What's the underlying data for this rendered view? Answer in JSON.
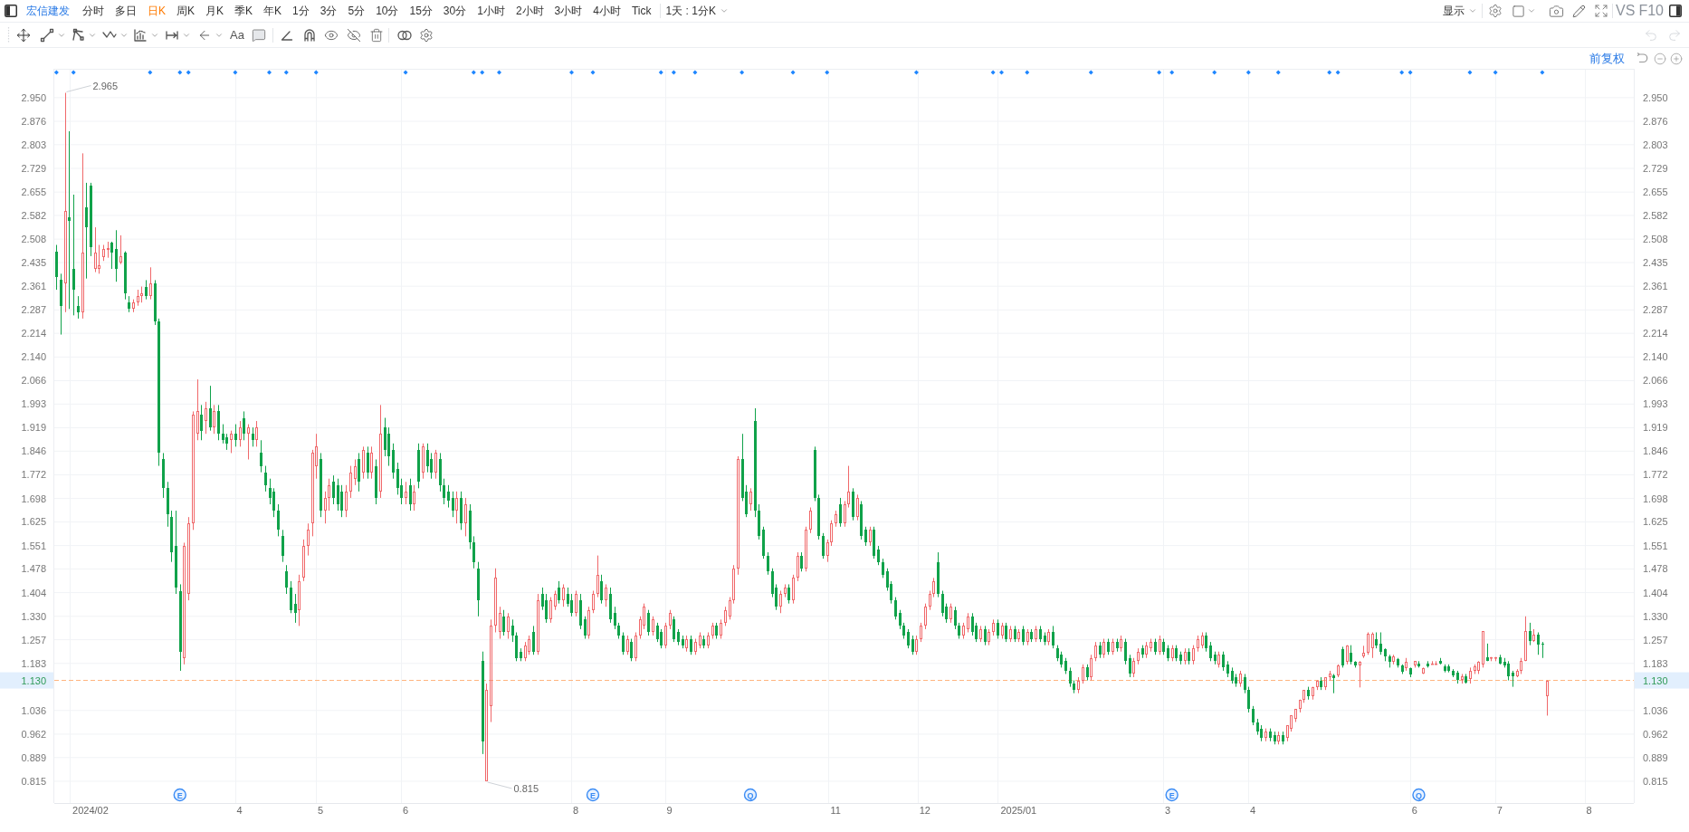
{
  "toolbar": {
    "symbol": "宏信建发",
    "periods": [
      {
        "label": "分时",
        "selected": false
      },
      {
        "label": "多日",
        "selected": false
      },
      {
        "label": "日K",
        "selected": true
      },
      {
        "label": "周K",
        "selected": false
      },
      {
        "label": "月K",
        "selected": false
      },
      {
        "label": "季K",
        "selected": false
      },
      {
        "label": "年K",
        "selected": false
      },
      {
        "label": "1分",
        "selected": false
      },
      {
        "label": "3分",
        "selected": false
      },
      {
        "label": "5分",
        "selected": false
      },
      {
        "label": "10分",
        "selected": false
      },
      {
        "label": "15分",
        "selected": false
      },
      {
        "label": "30分",
        "selected": false
      },
      {
        "label": "1小时",
        "selected": false
      },
      {
        "label": "2小时",
        "selected": false
      },
      {
        "label": "3小时",
        "selected": false
      },
      {
        "label": "4小时",
        "selected": false
      },
      {
        "label": "Tick",
        "selected": false
      }
    ],
    "interval_menu": "1天 : 1分K",
    "display_menu": "显示",
    "compare_button": "VS",
    "f10_button": "F10"
  },
  "drawing_toolbar": {
    "text_tool": "Aa",
    "undo": {
      "disabled": true
    },
    "redo": {
      "disabled": true
    }
  },
  "chart": {
    "adjust_mode": "前复权",
    "chart_data": {
      "type": "candlestick",
      "grid": true,
      "ylim": [
        0.747,
        3.04
      ],
      "ref_lines": [
        {
          "axis": "y",
          "value": 1.13
        }
      ],
      "yticks": [
        {
          "value": 2.95,
          "label": "2.950"
        },
        {
          "value": 2.876,
          "label": "2.876"
        },
        {
          "value": 2.803,
          "label": "2.803"
        },
        {
          "value": 2.729,
          "label": "2.729"
        },
        {
          "value": 2.655,
          "label": "2.655"
        },
        {
          "value": 2.582,
          "label": "2.582"
        },
        {
          "value": 2.508,
          "label": "2.508"
        },
        {
          "value": 2.435,
          "label": "2.435"
        },
        {
          "value": 2.361,
          "label": "2.361"
        },
        {
          "value": 2.287,
          "label": "2.287"
        },
        {
          "value": 2.214,
          "label": "2.214"
        },
        {
          "value": 2.14,
          "label": "2.140"
        },
        {
          "value": 2.066,
          "label": "2.066"
        },
        {
          "value": 1.993,
          "label": "1.993"
        },
        {
          "value": 1.919,
          "label": "1.919"
        },
        {
          "value": 1.846,
          "label": "1.846"
        },
        {
          "value": 1.772,
          "label": "1.772"
        },
        {
          "value": 1.698,
          "label": "1.698"
        },
        {
          "value": 1.625,
          "label": "1.625"
        },
        {
          "value": 1.551,
          "label": "1.551"
        },
        {
          "value": 1.478,
          "label": "1.478"
        },
        {
          "value": 1.404,
          "label": "1.404"
        },
        {
          "value": 1.33,
          "label": "1.330"
        },
        {
          "value": 1.257,
          "label": "1.257"
        },
        {
          "value": 1.183,
          "label": "1.183"
        },
        {
          "value": 1.036,
          "label": "1.036"
        },
        {
          "value": 0.962,
          "label": "0.962"
        },
        {
          "value": 0.889,
          "label": "0.889"
        },
        {
          "value": 0.815,
          "label": "0.815"
        }
      ],
      "categories": [
        null,
        null,
        null,
        null,
        null,
        null,
        null,
        null,
        "2024/02",
        null,
        null,
        null,
        null,
        null,
        null,
        null,
        null,
        null,
        null,
        null,
        null,
        null,
        null,
        null,
        null,
        null,
        null,
        null,
        null,
        null,
        null,
        null,
        null,
        null,
        null,
        null,
        null,
        null,
        null,
        null,
        null,
        null,
        null,
        "4",
        null,
        null,
        null,
        null,
        null,
        null,
        null,
        null,
        null,
        null,
        null,
        null,
        null,
        null,
        null,
        null,
        null,
        null,
        "5",
        null,
        null,
        null,
        null,
        null,
        null,
        null,
        null,
        null,
        null,
        null,
        null,
        null,
        null,
        null,
        null,
        null,
        null,
        null,
        "6",
        null,
        null,
        null,
        null,
        null,
        null,
        null,
        null,
        null,
        null,
        null,
        null,
        null,
        null,
        null,
        null,
        null,
        null,
        null,
        null,
        null,
        null,
        null,
        null,
        null,
        null,
        null,
        null,
        null,
        null,
        null,
        null,
        null,
        null,
        null,
        null,
        null,
        null,
        null,
        "8",
        null,
        null,
        null,
        null,
        null,
        null,
        null,
        null,
        null,
        null,
        null,
        null,
        null,
        null,
        null,
        null,
        null,
        null,
        null,
        null,
        null,
        "9",
        null,
        null,
        null,
        null,
        null,
        null,
        null,
        null,
        null,
        null,
        null,
        null,
        null,
        null,
        null,
        null,
        null,
        null,
        null,
        null,
        null,
        null,
        null,
        null,
        null,
        null,
        null,
        null,
        null,
        null,
        null,
        null,
        null,
        null,
        null,
        null,
        null,
        null,
        "11",
        null,
        null,
        null,
        null,
        null,
        null,
        null,
        null,
        null,
        null,
        null,
        null,
        null,
        null,
        null,
        null,
        null,
        null,
        null,
        null,
        "12",
        null,
        null,
        null,
        null,
        null,
        null,
        null,
        null,
        null,
        null,
        null,
        null,
        null,
        null,
        null,
        null,
        null,
        null,
        null,
        null,
        null,
        "2025/01",
        null,
        null,
        null,
        null,
        null,
        null,
        null,
        null,
        null,
        null,
        null,
        null,
        null,
        null,
        null,
        null,
        null,
        null,
        null,
        null,
        null,
        null,
        null,
        null,
        null,
        null,
        null,
        null,
        null,
        null,
        null,
        null,
        null,
        null,
        "3",
        null,
        null,
        null,
        null,
        null,
        null,
        null,
        null,
        null,
        null,
        null,
        null,
        null,
        null,
        null,
        null,
        null,
        null,
        null,
        "4",
        null,
        null,
        null,
        null,
        null,
        null,
        null,
        null,
        null,
        null,
        null,
        null,
        null,
        null,
        null,
        null,
        null,
        null,
        null,
        null,
        null,
        null,
        null,
        null,
        null,
        null,
        null,
        null,
        null,
        null,
        null,
        null,
        null,
        null,
        null,
        null,
        null,
        "6",
        null,
        null,
        null,
        null,
        null,
        null,
        null,
        null,
        null,
        null,
        null,
        null,
        null,
        null,
        null,
        null,
        null,
        null,
        null,
        "7",
        null,
        null,
        null,
        null,
        null,
        null,
        null,
        null,
        null,
        null,
        null,
        null,
        null,
        null,
        null,
        null,
        null,
        null,
        null,
        null,
        "8",
        null,
        null,
        null,
        null,
        null,
        null,
        null,
        null,
        null,
        null
      ],
      "ohlc": [
        [
          2.47,
          2.49,
          2.35,
          2.39
        ],
        [
          2.38,
          2.4,
          2.21,
          2.3
        ],
        [
          2.37,
          2.965,
          2.28,
          2.595
        ],
        [
          2.575,
          2.845,
          2.29,
          2.565
        ],
        [
          2.415,
          2.647,
          2.27,
          2.35
        ],
        [
          2.3,
          2.33,
          2.26,
          2.28
        ],
        [
          2.28,
          2.776,
          2.26,
          2.465
        ],
        [
          2.607,
          2.684,
          2.385,
          2.545
        ],
        [
          2.675,
          2.684,
          2.455,
          2.484
        ],
        [
          2.415,
          2.545,
          2.405,
          2.465
        ],
        [
          2.415,
          2.49,
          2.4,
          2.426
        ],
        [
          2.452,
          2.49,
          2.44,
          2.477
        ],
        [
          2.475,
          2.5,
          2.45,
          2.48
        ],
        [
          2.497,
          2.5,
          2.415,
          2.465
        ],
        [
          2.477,
          2.536,
          2.375,
          2.415
        ],
        [
          2.435,
          2.52,
          2.43,
          2.455
        ],
        [
          2.465,
          2.47,
          2.32,
          2.34
        ],
        [
          2.31,
          2.33,
          2.28,
          2.29
        ],
        [
          2.29,
          2.32,
          2.28,
          2.31
        ],
        [
          2.31,
          2.35,
          2.3,
          2.33
        ],
        [
          2.33,
          2.36,
          2.31,
          2.34
        ],
        [
          2.36,
          2.38,
          2.32,
          2.33
        ],
        [
          2.33,
          2.42,
          2.32,
          2.37
        ],
        [
          2.37,
          2.38,
          2.24,
          2.25
        ],
        [
          2.25,
          2.26,
          1.8,
          1.84
        ],
        [
          1.82,
          1.84,
          1.7,
          1.73
        ],
        [
          1.73,
          1.75,
          1.61,
          1.65
        ],
        [
          1.64,
          1.66,
          1.5,
          1.53
        ],
        [
          1.55,
          1.66,
          1.4,
          1.42
        ],
        [
          1.41,
          1.43,
          1.16,
          1.22
        ],
        [
          1.2,
          1.56,
          1.18,
          1.55
        ],
        [
          1.4,
          1.64,
          1.38,
          1.62
        ],
        [
          1.62,
          1.97,
          1.6,
          1.96
        ],
        [
          1.9,
          2.07,
          1.88,
          1.97
        ],
        [
          1.96,
          1.99,
          1.88,
          1.91
        ],
        [
          1.94,
          2,
          1.9,
          1.98
        ],
        [
          1.98,
          2.05,
          1.91,
          1.92
        ],
        [
          1.92,
          1.99,
          1.9,
          1.97
        ],
        [
          1.97,
          1.99,
          1.88,
          1.9
        ],
        [
          1.9,
          1.93,
          1.87,
          1.88
        ],
        [
          1.89,
          1.9,
          1.85,
          1.87
        ],
        [
          1.88,
          1.91,
          1.84,
          1.9
        ],
        [
          1.9,
          1.93,
          1.86,
          1.88
        ],
        [
          1.88,
          1.94,
          1.86,
          1.92
        ],
        [
          1.95,
          1.97,
          1.88,
          1.9
        ],
        [
          1.9,
          1.93,
          1.82,
          1.92
        ],
        [
          1.9,
          1.92,
          1.86,
          1.88
        ],
        [
          1.88,
          1.94,
          1.86,
          1.92
        ],
        [
          1.84,
          1.88,
          1.78,
          1.8
        ],
        [
          1.78,
          1.8,
          1.72,
          1.74
        ],
        [
          1.73,
          1.76,
          1.68,
          1.7
        ],
        [
          1.72,
          1.73,
          1.64,
          1.66
        ],
        [
          1.66,
          1.68,
          1.58,
          1.6
        ],
        [
          1.58,
          1.6,
          1.5,
          1.52
        ],
        [
          1.47,
          1.49,
          1.4,
          1.42
        ],
        [
          1.42,
          1.44,
          1.34,
          1.35
        ],
        [
          1.37,
          1.4,
          1.31,
          1.34
        ],
        [
          1.35,
          1.46,
          1.3,
          1.44
        ],
        [
          1.45,
          1.57,
          1.44,
          1.55
        ],
        [
          1.55,
          1.62,
          1.52,
          1.6
        ],
        [
          1.62,
          1.85,
          1.58,
          1.84
        ],
        [
          1.8,
          1.9,
          1.76,
          1.86
        ],
        [
          1.82,
          1.84,
          1.64,
          1.66
        ],
        [
          1.66,
          1.72,
          1.62,
          1.7
        ],
        [
          1.7,
          1.76,
          1.66,
          1.74
        ],
        [
          1.75,
          1.77,
          1.68,
          1.7
        ],
        [
          1.74,
          1.76,
          1.66,
          1.68
        ],
        [
          1.72,
          1.74,
          1.64,
          1.66
        ],
        [
          1.66,
          1.74,
          1.64,
          1.72
        ],
        [
          1.72,
          1.8,
          1.7,
          1.78
        ],
        [
          1.76,
          1.82,
          1.74,
          1.8
        ],
        [
          1.82,
          1.84,
          1.72,
          1.75
        ],
        [
          1.78,
          1.86,
          1.76,
          1.85
        ],
        [
          1.84,
          1.86,
          1.76,
          1.78
        ],
        [
          1.78,
          1.86,
          1.76,
          1.84
        ],
        [
          1.8,
          1.82,
          1.68,
          1.7
        ],
        [
          1.72,
          1.99,
          1.7,
          1.9
        ],
        [
          1.92,
          1.95,
          1.83,
          1.85
        ],
        [
          1.9,
          1.92,
          1.8,
          1.83
        ],
        [
          1.85,
          1.87,
          1.76,
          1.78
        ],
        [
          1.79,
          1.81,
          1.71,
          1.73
        ],
        [
          1.74,
          1.76,
          1.68,
          1.7
        ],
        [
          1.7,
          1.75,
          1.68,
          1.72
        ],
        [
          1.74,
          1.76,
          1.66,
          1.68
        ],
        [
          1.68,
          1.74,
          1.66,
          1.72
        ],
        [
          1.85,
          1.87,
          1.73,
          1.75
        ],
        [
          1.78,
          1.87,
          1.76,
          1.86
        ],
        [
          1.85,
          1.87,
          1.78,
          1.8
        ],
        [
          1.82,
          1.84,
          1.76,
          1.78
        ],
        [
          1.78,
          1.85,
          1.76,
          1.84
        ],
        [
          1.82,
          1.84,
          1.72,
          1.74
        ],
        [
          1.74,
          1.76,
          1.68,
          1.7
        ],
        [
          1.72,
          1.74,
          1.67,
          1.69
        ],
        [
          1.7,
          1.72,
          1.64,
          1.66
        ],
        [
          1.66,
          1.72,
          1.62,
          1.7
        ],
        [
          1.7,
          1.72,
          1.6,
          1.62
        ],
        [
          1.62,
          1.7,
          1.58,
          1.68
        ],
        [
          1.66,
          1.68,
          1.54,
          1.56
        ],
        [
          1.56,
          1.58,
          1.48,
          1.5
        ],
        [
          1.48,
          1.5,
          1.33,
          1.38
        ],
        [
          1.19,
          1.22,
          0.9,
          0.94
        ],
        [
          0.815,
          1.12,
          0.815,
          1.1
        ],
        [
          1.05,
          1.32,
          1,
          1.3
        ],
        [
          1.3,
          1.48,
          1.28,
          1.45
        ],
        [
          1.28,
          1.36,
          1.26,
          1.34
        ],
        [
          1.33,
          1.35,
          1.27,
          1.28
        ],
        [
          1.28,
          1.34,
          1.26,
          1.33
        ],
        [
          1.3,
          1.32,
          1.25,
          1.27
        ],
        [
          1.27,
          1.28,
          1.19,
          1.2
        ],
        [
          1.22,
          1.23,
          1.19,
          1.2
        ],
        [
          1.2,
          1.25,
          1.19,
          1.24
        ],
        [
          1.22,
          1.27,
          1.21,
          1.26
        ],
        [
          1.28,
          1.3,
          1.21,
          1.22
        ],
        [
          1.22,
          1.4,
          1.21,
          1.38
        ],
        [
          1.4,
          1.42,
          1.35,
          1.36
        ],
        [
          1.38,
          1.4,
          1.31,
          1.32
        ],
        [
          1.32,
          1.39,
          1.31,
          1.38
        ],
        [
          1.36,
          1.41,
          1.35,
          1.4
        ],
        [
          1.42,
          1.44,
          1.37,
          1.38
        ],
        [
          1.38,
          1.43,
          1.36,
          1.42
        ],
        [
          1.4,
          1.42,
          1.36,
          1.37
        ],
        [
          1.38,
          1.4,
          1.33,
          1.34
        ],
        [
          1.34,
          1.41,
          1.33,
          1.4
        ],
        [
          1.38,
          1.4,
          1.29,
          1.3
        ],
        [
          1.32,
          1.33,
          1.26,
          1.27
        ],
        [
          1.27,
          1.36,
          1.26,
          1.35
        ],
        [
          1.35,
          1.41,
          1.34,
          1.4
        ],
        [
          1.4,
          1.52,
          1.39,
          1.46
        ],
        [
          1.44,
          1.46,
          1.37,
          1.38
        ],
        [
          1.38,
          1.43,
          1.36,
          1.42
        ],
        [
          1.4,
          1.42,
          1.31,
          1.32
        ],
        [
          1.34,
          1.36,
          1.29,
          1.3
        ],
        [
          1.3,
          1.31,
          1.26,
          1.27
        ],
        [
          1.27,
          1.28,
          1.21,
          1.22
        ],
        [
          1.22,
          1.27,
          1.21,
          1.26
        ],
        [
          1.25,
          1.26,
          1.19,
          1.2
        ],
        [
          1.2,
          1.28,
          1.19,
          1.27
        ],
        [
          1.27,
          1.33,
          1.26,
          1.32
        ],
        [
          1.3,
          1.37,
          1.29,
          1.36
        ],
        [
          1.34,
          1.35,
          1.27,
          1.28
        ],
        [
          1.28,
          1.33,
          1.27,
          1.32
        ],
        [
          1.3,
          1.31,
          1.25,
          1.26
        ],
        [
          1.28,
          1.29,
          1.23,
          1.24
        ],
        [
          1.24,
          1.31,
          1.23,
          1.3
        ],
        [
          1.3,
          1.35,
          1.29,
          1.34
        ],
        [
          1.32,
          1.33,
          1.25,
          1.26
        ],
        [
          1.28,
          1.29,
          1.24,
          1.25
        ],
        [
          1.26,
          1.27,
          1.23,
          1.24
        ],
        [
          1.23,
          1.27,
          1.22,
          1.26
        ],
        [
          1.26,
          1.27,
          1.21,
          1.22
        ],
        [
          1.22,
          1.26,
          1.21,
          1.25
        ],
        [
          1.24,
          1.28,
          1.23,
          1.27
        ],
        [
          1.26,
          1.27,
          1.23,
          1.24
        ],
        [
          1.24,
          1.28,
          1.23,
          1.27
        ],
        [
          1.27,
          1.31,
          1.26,
          1.3
        ],
        [
          1.3,
          1.31,
          1.26,
          1.27
        ],
        [
          1.27,
          1.32,
          1.26,
          1.31
        ],
        [
          1.31,
          1.36,
          1.3,
          1.35
        ],
        [
          1.33,
          1.39,
          1.32,
          1.38
        ],
        [
          1.38,
          1.49,
          1.37,
          1.48
        ],
        [
          1.48,
          1.83,
          1.46,
          1.82
        ],
        [
          1.82,
          1.9,
          1.69,
          1.7
        ],
        [
          1.72,
          1.74,
          1.64,
          1.65
        ],
        [
          1.68,
          1.73,
          1.66,
          1.72
        ],
        [
          1.94,
          1.98,
          1.64,
          1.66
        ],
        [
          1.66,
          1.68,
          1.57,
          1.58
        ],
        [
          1.6,
          1.61,
          1.51,
          1.52
        ],
        [
          1.52,
          1.53,
          1.46,
          1.47
        ],
        [
          1.47,
          1.48,
          1.39,
          1.4
        ],
        [
          1.42,
          1.43,
          1.35,
          1.36
        ],
        [
          1.36,
          1.41,
          1.34,
          1.4
        ],
        [
          1.4,
          1.43,
          1.39,
          1.42
        ],
        [
          1.42,
          1.43,
          1.37,
          1.38
        ],
        [
          1.38,
          1.46,
          1.37,
          1.45
        ],
        [
          1.45,
          1.53,
          1.44,
          1.52
        ],
        [
          1.52,
          1.53,
          1.47,
          1.48
        ],
        [
          1.48,
          1.61,
          1.47,
          1.6
        ],
        [
          1.6,
          1.67,
          1.59,
          1.66
        ],
        [
          1.85,
          1.86,
          1.69,
          1.7
        ],
        [
          1.7,
          1.71,
          1.57,
          1.58
        ],
        [
          1.58,
          1.59,
          1.51,
          1.52
        ],
        [
          1.52,
          1.57,
          1.5,
          1.56
        ],
        [
          1.56,
          1.63,
          1.55,
          1.62
        ],
        [
          1.62,
          1.66,
          1.61,
          1.65
        ],
        [
          1.68,
          1.7,
          1.61,
          1.62
        ],
        [
          1.62,
          1.69,
          1.61,
          1.68
        ],
        [
          1.68,
          1.8,
          1.67,
          1.72
        ],
        [
          1.72,
          1.73,
          1.63,
          1.64
        ],
        [
          1.64,
          1.71,
          1.63,
          1.7
        ],
        [
          1.68,
          1.69,
          1.57,
          1.58
        ],
        [
          1.6,
          1.61,
          1.55,
          1.56
        ],
        [
          1.56,
          1.61,
          1.55,
          1.6
        ],
        [
          1.6,
          1.61,
          1.51,
          1.52
        ],
        [
          1.54,
          1.55,
          1.49,
          1.5
        ],
        [
          1.5,
          1.51,
          1.45,
          1.46
        ],
        [
          1.47,
          1.48,
          1.41,
          1.42
        ],
        [
          1.43,
          1.44,
          1.37,
          1.38
        ],
        [
          1.38,
          1.39,
          1.32,
          1.33
        ],
        [
          1.34,
          1.35,
          1.29,
          1.3
        ],
        [
          1.3,
          1.31,
          1.26,
          1.27
        ],
        [
          1.28,
          1.29,
          1.23,
          1.24
        ],
        [
          1.26,
          1.27,
          1.21,
          1.22
        ],
        [
          1.22,
          1.27,
          1.21,
          1.26
        ],
        [
          1.26,
          1.31,
          1.25,
          1.3
        ],
        [
          1.3,
          1.37,
          1.29,
          1.36
        ],
        [
          1.36,
          1.41,
          1.35,
          1.4
        ],
        [
          1.4,
          1.45,
          1.39,
          1.44
        ],
        [
          1.5,
          1.53,
          1.39,
          1.4
        ],
        [
          1.4,
          1.41,
          1.33,
          1.34
        ],
        [
          1.36,
          1.37,
          1.31,
          1.32
        ],
        [
          1.32,
          1.37,
          1.31,
          1.36
        ],
        [
          1.35,
          1.36,
          1.29,
          1.3
        ],
        [
          1.3,
          1.31,
          1.26,
          1.27
        ],
        [
          1.27,
          1.31,
          1.26,
          1.3
        ],
        [
          1.29,
          1.34,
          1.28,
          1.33
        ],
        [
          1.33,
          1.34,
          1.27,
          1.28
        ],
        [
          1.3,
          1.31,
          1.25,
          1.26
        ],
        [
          1.26,
          1.3,
          1.25,
          1.29
        ],
        [
          1.29,
          1.3,
          1.24,
          1.25
        ],
        [
          1.25,
          1.29,
          1.24,
          1.28
        ],
        [
          1.28,
          1.32,
          1.27,
          1.31
        ],
        [
          1.31,
          1.32,
          1.26,
          1.27
        ],
        [
          1.27,
          1.31,
          1.26,
          1.3
        ],
        [
          1.3,
          1.31,
          1.25,
          1.26
        ],
        [
          1.26,
          1.3,
          1.25,
          1.29
        ],
        [
          1.29,
          1.3,
          1.25,
          1.26
        ],
        [
          1.26,
          1.29,
          1.25,
          1.28
        ],
        [
          1.29,
          1.3,
          1.24,
          1.25
        ],
        [
          1.25,
          1.29,
          1.24,
          1.28
        ],
        [
          1.28,
          1.29,
          1.25,
          1.26
        ],
        [
          1.26,
          1.3,
          1.25,
          1.29
        ],
        [
          1.29,
          1.3,
          1.25,
          1.26
        ],
        [
          1.27,
          1.28,
          1.24,
          1.25
        ],
        [
          1.25,
          1.29,
          1.24,
          1.28
        ],
        [
          1.28,
          1.3,
          1.23,
          1.24
        ],
        [
          1.23,
          1.24,
          1.19,
          1.2
        ],
        [
          1.21,
          1.22,
          1.17,
          1.18
        ],
        [
          1.19,
          1.2,
          1.15,
          1.16
        ],
        [
          1.16,
          1.17,
          1.11,
          1.12
        ],
        [
          1.12,
          1.13,
          1.09,
          1.1
        ],
        [
          1.1,
          1.14,
          1.09,
          1.13
        ],
        [
          1.13,
          1.18,
          1.12,
          1.17
        ],
        [
          1.17,
          1.18,
          1.13,
          1.14
        ],
        [
          1.14,
          1.21,
          1.13,
          1.2
        ],
        [
          1.2,
          1.25,
          1.19,
          1.24
        ],
        [
          1.24,
          1.25,
          1.2,
          1.21
        ],
        [
          1.21,
          1.26,
          1.2,
          1.25
        ],
        [
          1.25,
          1.26,
          1.21,
          1.22
        ],
        [
          1.22,
          1.26,
          1.21,
          1.25
        ],
        [
          1.25,
          1.26,
          1.22,
          1.23
        ],
        [
          1.23,
          1.27,
          1.22,
          1.26
        ],
        [
          1.25,
          1.26,
          1.18,
          1.19
        ],
        [
          1.2,
          1.21,
          1.14,
          1.15
        ],
        [
          1.15,
          1.2,
          1.14,
          1.19
        ],
        [
          1.19,
          1.23,
          1.18,
          1.22
        ],
        [
          1.23,
          1.24,
          1.2,
          1.21
        ],
        [
          1.21,
          1.25,
          1.2,
          1.24
        ],
        [
          1.23,
          1.26,
          1.22,
          1.25
        ],
        [
          1.25,
          1.26,
          1.21,
          1.22
        ],
        [
          1.22,
          1.27,
          1.21,
          1.26
        ],
        [
          1.25,
          1.26,
          1.21,
          1.22
        ],
        [
          1.23,
          1.24,
          1.19,
          1.2
        ],
        [
          1.2,
          1.24,
          1.19,
          1.23
        ],
        [
          1.23,
          1.24,
          1.19,
          1.2
        ],
        [
          1.21,
          1.22,
          1.18,
          1.19
        ],
        [
          1.19,
          1.23,
          1.18,
          1.22
        ],
        [
          1.22,
          1.23,
          1.18,
          1.19
        ],
        [
          1.19,
          1.24,
          1.18,
          1.23
        ],
        [
          1.23,
          1.27,
          1.22,
          1.26
        ],
        [
          1.24,
          1.28,
          1.23,
          1.27
        ],
        [
          1.27,
          1.28,
          1.22,
          1.23
        ],
        [
          1.24,
          1.25,
          1.19,
          1.2
        ],
        [
          1.21,
          1.22,
          1.18,
          1.19
        ],
        [
          1.18,
          1.22,
          1.17,
          1.21
        ],
        [
          1.21,
          1.22,
          1.16,
          1.17
        ],
        [
          1.18,
          1.19,
          1.14,
          1.15
        ],
        [
          1.16,
          1.17,
          1.12,
          1.13
        ],
        [
          1.14,
          1.15,
          1.11,
          1.12
        ],
        [
          1.12,
          1.16,
          1.11,
          1.15
        ],
        [
          1.14,
          1.15,
          1.09,
          1.1
        ],
        [
          1.1,
          1.11,
          1.03,
          1.04
        ],
        [
          1.04,
          1.05,
          0.99,
          1
        ],
        [
          1,
          1.01,
          0.96,
          0.97
        ],
        [
          0.98,
          0.99,
          0.94,
          0.95
        ],
        [
          0.95,
          0.98,
          0.94,
          0.97
        ],
        [
          0.97,
          0.98,
          0.94,
          0.95
        ],
        [
          0.96,
          0.97,
          0.93,
          0.94
        ],
        [
          0.94,
          0.97,
          0.93,
          0.96
        ],
        [
          0.96,
          0.97,
          0.93,
          0.94
        ],
        [
          0.95,
          0.99,
          0.94,
          0.99
        ],
        [
          0.98,
          1.02,
          0.97,
          1.02
        ],
        [
          1.01,
          1.04,
          1,
          1.04
        ],
        [
          1.04,
          1.07,
          1.03,
          1.07
        ],
        [
          1.07,
          1.1,
          1.06,
          1.1
        ],
        [
          1.1,
          1.11,
          1.07,
          1.08
        ],
        [
          1.08,
          1.11,
          1.07,
          1.11
        ],
        [
          1.11,
          1.13,
          1.1,
          1.13
        ],
        [
          1.13,
          1.14,
          1.1,
          1.11
        ],
        [
          1.11,
          1.14,
          1.1,
          1.14
        ],
        [
          1.14,
          1.16,
          1.13,
          1.15
        ],
        [
          1.145,
          1.15,
          1.09,
          1.136
        ],
        [
          1.145,
          1.18,
          1.14,
          1.178
        ],
        [
          1.227,
          1.235,
          1.17,
          1.178
        ],
        [
          1.188,
          1.24,
          1.18,
          1.238
        ],
        [
          1.216,
          1.24,
          1.18,
          1.188
        ],
        [
          1.188,
          1.19,
          1.17,
          1.176
        ],
        [
          1.176,
          1.19,
          1.108,
          1.188
        ],
        [
          1.206,
          1.238,
          1.2,
          1.216
        ],
        [
          1.216,
          1.28,
          1.21,
          1.277
        ],
        [
          1.23,
          1.28,
          1.2,
          1.277
        ],
        [
          1.258,
          1.28,
          1.23,
          1.238
        ],
        [
          1.246,
          1.28,
          1.21,
          1.218
        ],
        [
          1.227,
          1.23,
          1.19,
          1.206
        ],
        [
          1.206,
          1.21,
          1.17,
          1.188
        ],
        [
          1.188,
          1.21,
          1.18,
          1.206
        ],
        [
          1.197,
          1.2,
          1.17,
          1.176
        ],
        [
          1.176,
          1.18,
          1.15,
          1.157
        ],
        [
          1.169,
          1.2,
          1.16,
          1.188
        ],
        [
          1.167,
          1.17,
          1.14,
          1.148
        ],
        [
          1.176,
          1.19,
          1.17,
          1.19
        ],
        [
          1.183,
          1.19,
          1.17,
          1.174
        ],
        [
          1.152,
          1.17,
          1.15,
          1.169
        ],
        [
          1.183,
          1.19,
          1.17,
          1.174
        ],
        [
          1.181,
          1.19,
          1.18,
          1.183
        ],
        [
          1.181,
          1.19,
          1.18,
          1.183
        ],
        [
          1.192,
          1.2,
          1.18,
          1.183
        ],
        [
          1.174,
          1.18,
          1.155,
          1.161
        ],
        [
          1.174,
          1.18,
          1.155,
          1.161
        ],
        [
          1.161,
          1.165,
          1.14,
          1.145
        ],
        [
          1.155,
          1.16,
          1.12,
          1.131
        ],
        [
          1.131,
          1.15,
          1.12,
          1.142
        ],
        [
          1.142,
          1.15,
          1.12,
          1.122
        ],
        [
          1.133,
          1.17,
          1.12,
          1.161
        ],
        [
          1.16,
          1.18,
          1.15,
          1.174
        ],
        [
          1.161,
          1.19,
          1.15,
          1.188
        ],
        [
          1.18,
          1.284,
          1.17,
          1.284
        ],
        [
          1.202,
          1.245,
          1.19,
          1.192
        ],
        [
          1.198,
          1.203,
          1.19,
          1.202
        ],
        [
          1.198,
          1.203,
          1.19,
          1.202
        ],
        [
          1.202,
          1.21,
          1.18,
          1.183
        ],
        [
          1.188,
          1.2,
          1.17,
          1.178
        ],
        [
          1.183,
          1.19,
          1.13,
          1.142
        ],
        [
          1.155,
          1.16,
          1.11,
          1.142
        ],
        [
          1.142,
          1.165,
          1.14,
          1.161
        ],
        [
          1.16,
          1.2,
          1.15,
          1.192
        ],
        [
          1.192,
          1.33,
          1.19,
          1.284
        ],
        [
          1.284,
          1.31,
          1.24,
          1.254
        ],
        [
          1.252,
          1.29,
          1.25,
          1.272
        ],
        [
          1.272,
          1.28,
          1.21,
          1.242
        ],
        [
          1.244,
          1.25,
          1.2,
          1.243
        ],
        [
          1.08,
          1.13,
          1.02,
          1.13
        ],
        null,
        null,
        null,
        null,
        null,
        null,
        null,
        null,
        null,
        null,
        null,
        null,
        null,
        null,
        null,
        null,
        null,
        null,
        null,
        null
      ]
    },
    "right_axis": {
      "labels": [
        "2.950",
        "2.876",
        "2.803",
        "2.729",
        "2.655",
        "2.582",
        "2.508",
        "2.435",
        "2.361",
        "2.287",
        "2.214",
        "2.140",
        "2.066",
        "1.993",
        "1.919",
        "1.846",
        "1.772",
        "1.698",
        "1.625",
        "1.551",
        "1.478",
        "1.404",
        "1.330",
        "1.257",
        "1.183",
        "1.036",
        "0.962",
        "0.889",
        "0.815"
      ]
    },
    "current_price": {
      "left_label": "1.130",
      "right_label": "1.130"
    },
    "extremes": {
      "high_label": "2.965",
      "low_label": "0.815"
    },
    "events": [
      "E",
      "E",
      "Q",
      "E",
      "Q"
    ]
  }
}
